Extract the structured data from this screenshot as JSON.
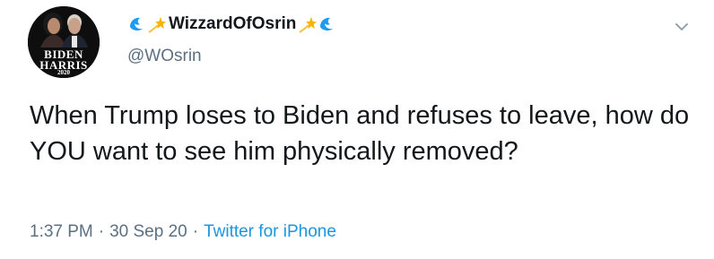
{
  "author": {
    "display_name": "WizzardOfOsrin",
    "handle": "@WOsrin",
    "avatar": {
      "line1": "BIDEN",
      "line2": "HARRIS",
      "year": "2020"
    },
    "name_emojis": {
      "left": [
        "water-wave-icon",
        "shooting-star-icon"
      ],
      "right": [
        "shooting-star-icon",
        "water-wave-icon"
      ]
    }
  },
  "tweet": {
    "text": "When Trump loses to Biden and refuses to leave, how do YOU want to see him physically removed?",
    "time": "1:37 PM",
    "date": "30 Sep 20",
    "separator": "·",
    "source": "Twitter for iPhone"
  },
  "colors": {
    "text": "#14171a",
    "secondary": "#5b7083",
    "link": "#1b95e0",
    "wave": "#1d9bf0",
    "star": "#f5b400"
  }
}
